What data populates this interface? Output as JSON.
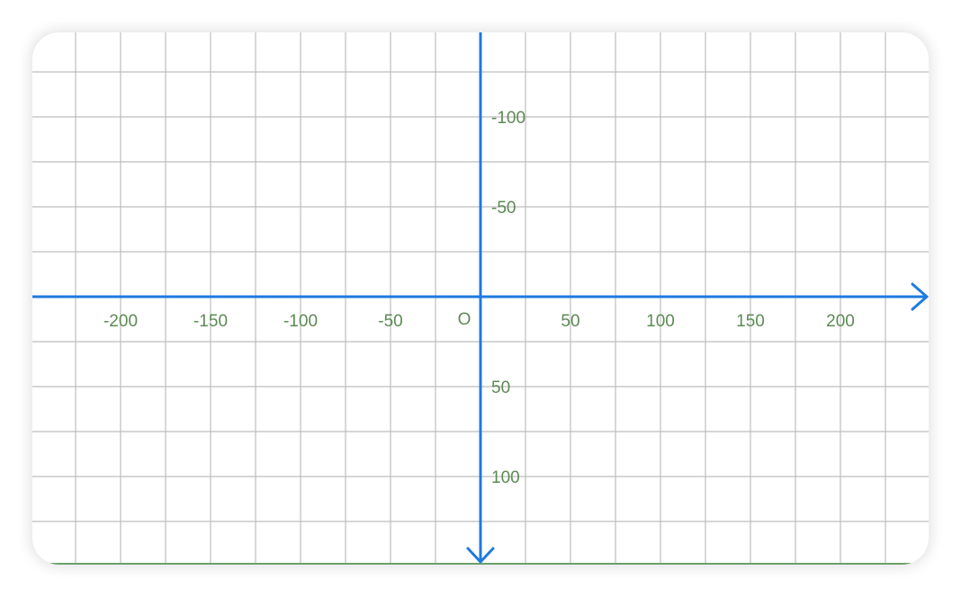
{
  "plane": {
    "origin_label": "O",
    "x_ticks": [
      {
        "value": -200,
        "label": "-200"
      },
      {
        "value": -150,
        "label": "-150"
      },
      {
        "value": -100,
        "label": "-100"
      },
      {
        "value": -50,
        "label": "-50"
      },
      {
        "value": 50,
        "label": "50"
      },
      {
        "value": 100,
        "label": "100"
      },
      {
        "value": 150,
        "label": "150"
      },
      {
        "value": 200,
        "label": "200"
      }
    ],
    "y_ticks": [
      {
        "value": -100,
        "label": "-100"
      },
      {
        "value": -50,
        "label": "-50"
      },
      {
        "value": 50,
        "label": "50"
      },
      {
        "value": 100,
        "label": "100"
      }
    ],
    "x_direction": "right",
    "y_direction": "down",
    "grid": true,
    "grid_step": 25,
    "colors": {
      "axis": "#1f7ae0",
      "grid": "#bdbdbd",
      "label": "#5d8a55",
      "bottom_edge": "#6aa06a"
    }
  }
}
